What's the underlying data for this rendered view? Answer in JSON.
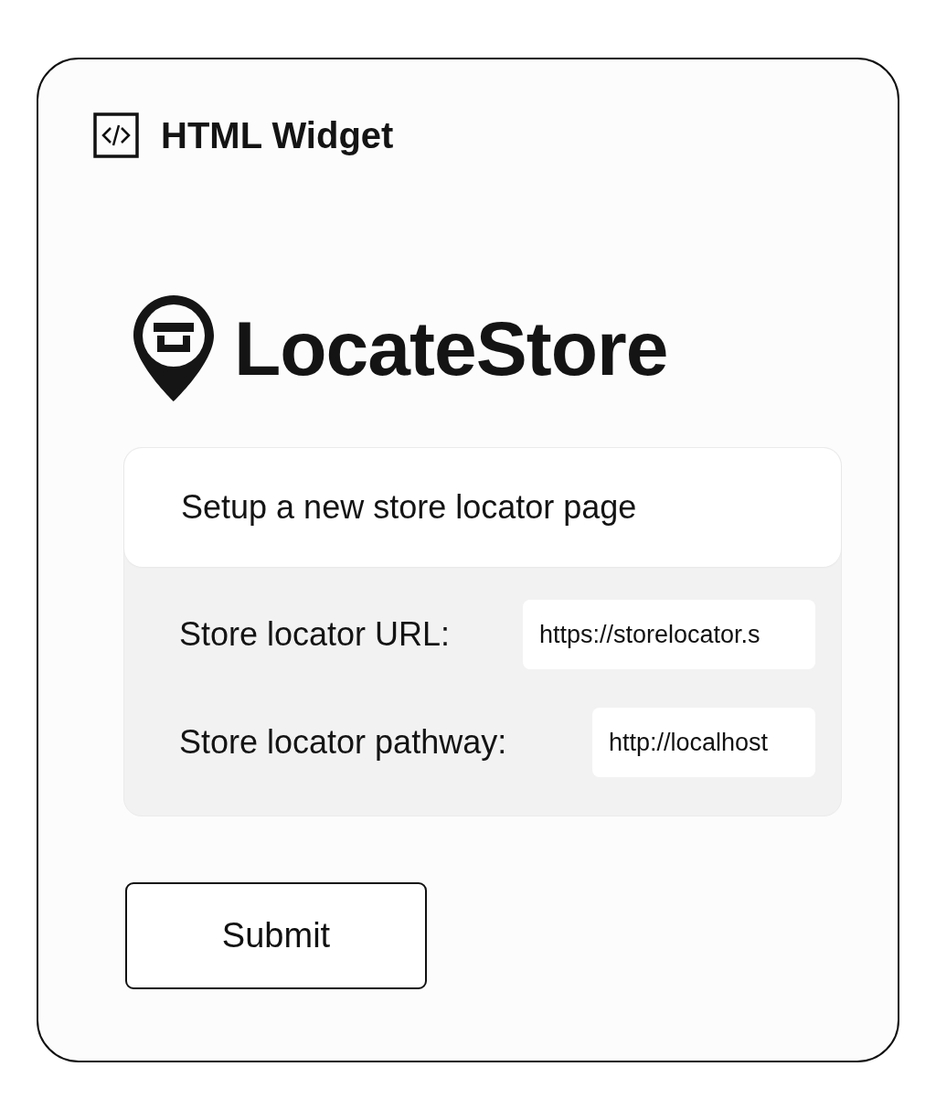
{
  "widget": {
    "title": "HTML Widget"
  },
  "logo": {
    "text": "LocateStore"
  },
  "form": {
    "heading": "Setup a new store locator page",
    "fields": [
      {
        "label": "Store locator URL:",
        "value": "https://storelocator.s"
      },
      {
        "label": "Store locator pathway:",
        "value": "http://localhost"
      }
    ]
  },
  "buttons": [
    "Submit"
  ]
}
